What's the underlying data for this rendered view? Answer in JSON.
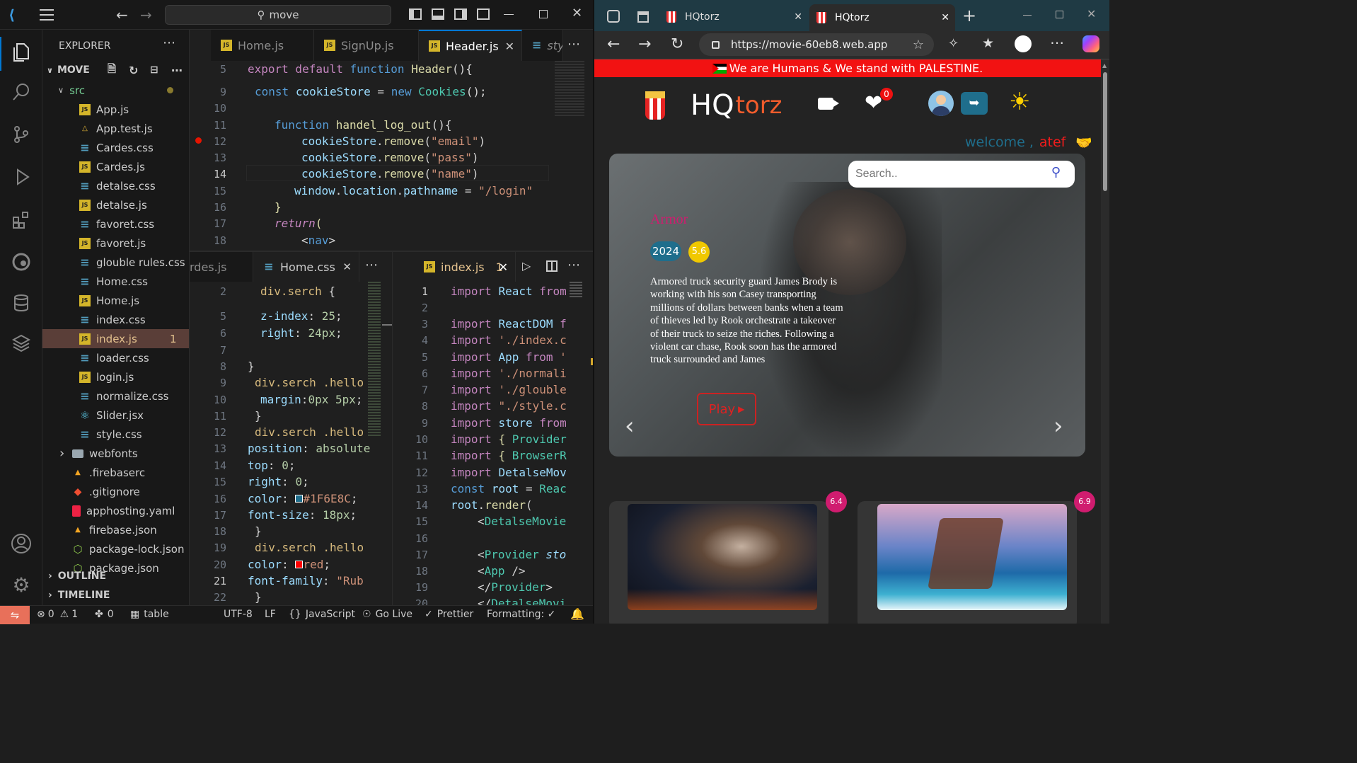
{
  "vscode": {
    "search_text": "move",
    "explorer_title": "EXPLORER",
    "folder_name": "MOVE",
    "src_label": "src",
    "files": [
      {
        "name": "App.js",
        "type": "js"
      },
      {
        "name": "App.test.js",
        "type": "test"
      },
      {
        "name": "Cardes.css",
        "type": "css"
      },
      {
        "name": "Cardes.js",
        "type": "js"
      },
      {
        "name": "detalse.css",
        "type": "css"
      },
      {
        "name": "detalse.js",
        "type": "js"
      },
      {
        "name": "favoret.css",
        "type": "css"
      },
      {
        "name": "favoret.js",
        "type": "js"
      },
      {
        "name": "glouble rules.css",
        "type": "css"
      },
      {
        "name": "Home.css",
        "type": "css"
      },
      {
        "name": "Home.js",
        "type": "js"
      },
      {
        "name": "index.css",
        "type": "css"
      },
      {
        "name": "index.js",
        "type": "js",
        "badge": "1"
      },
      {
        "name": "loader.css",
        "type": "css"
      },
      {
        "name": "login.js",
        "type": "js"
      },
      {
        "name": "normalize.css",
        "type": "css"
      },
      {
        "name": "Slider.jsx",
        "type": "react"
      },
      {
        "name": "style.css",
        "type": "css"
      }
    ],
    "root_items": [
      {
        "name": "webfonts",
        "type": "folder"
      },
      {
        "name": ".firebaserc",
        "type": "firebase"
      },
      {
        "name": ".gitignore",
        "type": "git"
      },
      {
        "name": "apphosting.yaml",
        "type": "yaml"
      },
      {
        "name": "firebase.json",
        "type": "firebase"
      },
      {
        "name": "package-lock.json",
        "type": "npm"
      },
      {
        "name": "package.json",
        "type": "npm"
      }
    ],
    "outline_label": "OUTLINE",
    "timeline_label": "TIMELINE",
    "top_tabs": [
      "Home.js",
      "SignUp.js",
      "Header.js",
      "sty"
    ],
    "left_tabs": [
      "rdes.js",
      "Home.css"
    ],
    "right_tabs": [
      "index.js"
    ],
    "right_tab_badge": "1",
    "status": {
      "errors": "0",
      "warnings": "1",
      "ports": "0",
      "table": "table",
      "encoding": "UTF-8",
      "eol": "LF",
      "lang": "JavaScript",
      "golive": "Go Live",
      "prettier": "Prettier",
      "formatting": "Formatting: ✓"
    }
  },
  "browser": {
    "tab1": "HQtorz",
    "tab2": "HQtorz",
    "url": "https://movie-60eb8.web.app",
    "banner": "We are Humans & We stand with PALESTINE.",
    "logo_hq": "HQ",
    "logo_torz": "torz",
    "fav_count": "0",
    "welcome": "welcome ,",
    "username": "atef",
    "search_placeholder": "Search..",
    "hero": {
      "title": "Armor",
      "year": "2024",
      "rating": "5.6",
      "description": "Armored truck security guard James Brody is working with his son Casey transporting millions of dollars between banks when a team of thieves led by Rook orchestrate a takeover of their truck to seize the riches. Following a violent car chase, Rook soon has the armored truck surrounded and James",
      "play": "Play"
    },
    "cards": [
      {
        "rating": "6.4"
      },
      {
        "rating": "6.9"
      }
    ]
  }
}
